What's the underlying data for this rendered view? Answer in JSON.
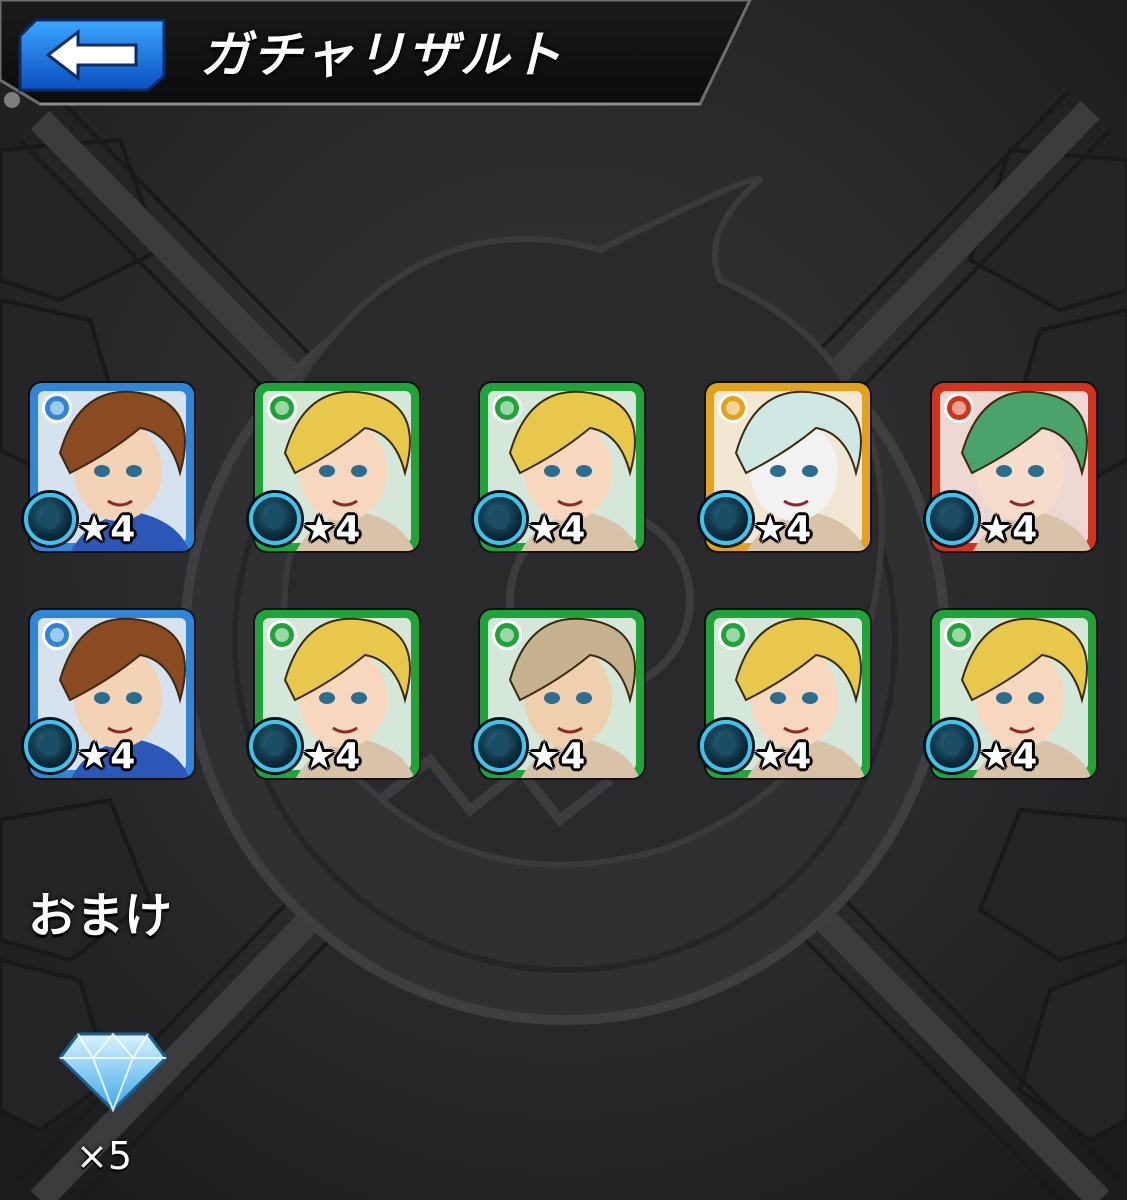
{
  "header": {
    "title": "ガチャリザルト",
    "back_label": "back"
  },
  "colors": {
    "water": "#2f86d8",
    "wood": "#1fa43a",
    "light": "#e3a11c",
    "fire": "#d3331c"
  },
  "results": [
    {
      "attribute": "water",
      "character": "brown-haired-boy",
      "rarity": "★4"
    },
    {
      "attribute": "wood",
      "character": "blonde-boy",
      "rarity": "★4"
    },
    {
      "attribute": "wood",
      "character": "blonde-boy",
      "rarity": "★4"
    },
    {
      "attribute": "light",
      "character": "unicorn",
      "rarity": "★4"
    },
    {
      "attribute": "fire",
      "character": "green-haired-girl",
      "rarity": "★4"
    },
    {
      "attribute": "water",
      "character": "brown-haired-boy",
      "rarity": "★4"
    },
    {
      "attribute": "wood",
      "character": "blonde-boy",
      "rarity": "★4"
    },
    {
      "attribute": "wood",
      "character": "light-haired-man",
      "rarity": "★4"
    },
    {
      "attribute": "wood",
      "character": "blonde-boy",
      "rarity": "★4"
    },
    {
      "attribute": "wood",
      "character": "blonde-boy",
      "rarity": "★4"
    }
  ],
  "bonus": {
    "label": "おまけ",
    "item_icon": "gem-icon",
    "count": "×5"
  }
}
